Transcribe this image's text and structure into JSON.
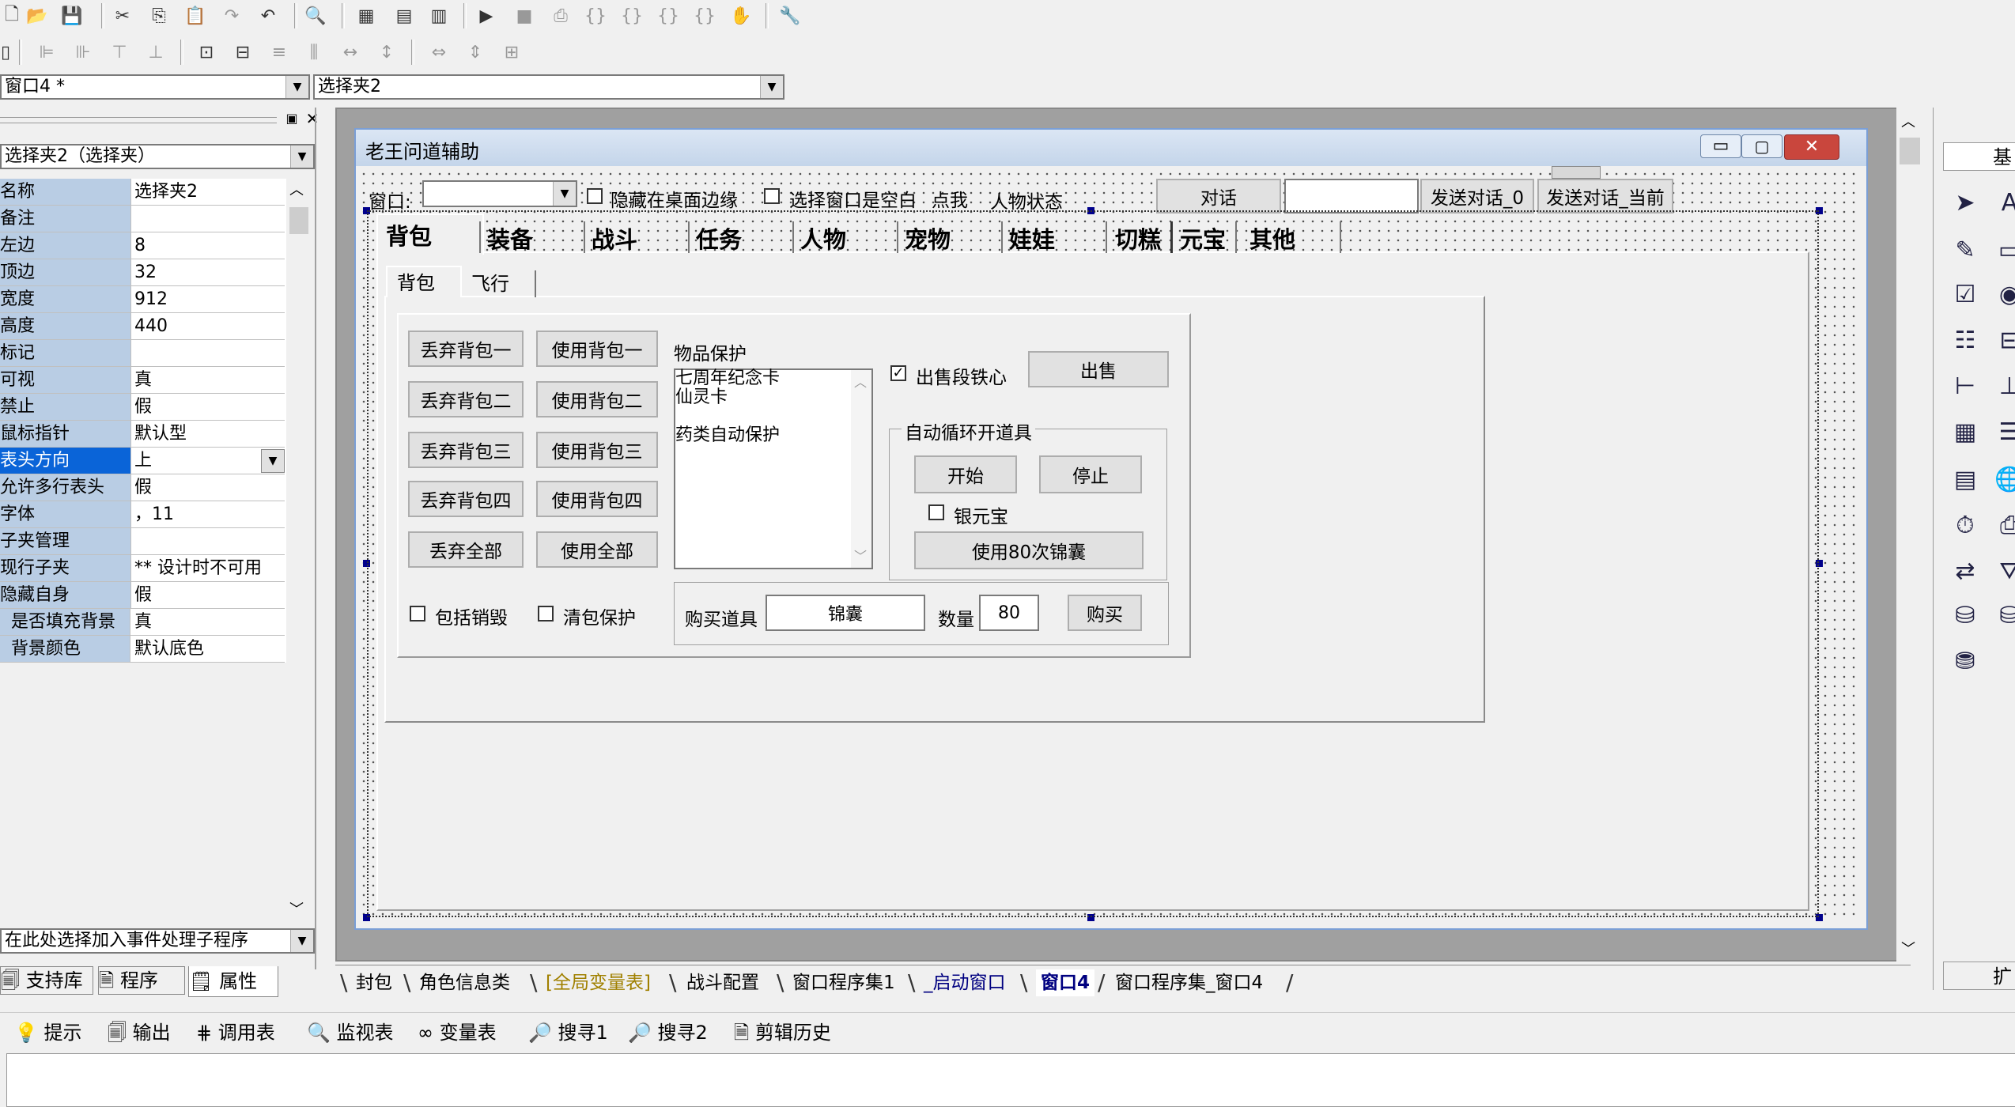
{
  "toolbar1": {
    "icons": [
      "new-icon",
      "open-icon",
      "save-icon",
      "cut-icon",
      "copy-icon",
      "paste-icon",
      "redo-icon",
      "undo-icon",
      "find-icon",
      "layout1-icon",
      "layout2-icon",
      "layout3-icon",
      "run-icon",
      "stop-icon",
      "step-icon",
      "step-into-icon",
      "step-over-icon",
      "step-out-icon",
      "run-to-icon",
      "hand-icon",
      "tools-icon"
    ]
  },
  "selectors": {
    "window_combo": "窗口4 *",
    "control_combo": "选择夹2"
  },
  "property_panel": {
    "object_combo": "选择夹2（选择夹）",
    "rows": [
      {
        "name": "名称",
        "value": "选择夹2"
      },
      {
        "name": "备注",
        "value": ""
      },
      {
        "name": "左边",
        "value": "8"
      },
      {
        "name": "顶边",
        "value": "32"
      },
      {
        "name": "宽度",
        "value": "912"
      },
      {
        "name": "高度",
        "value": "440"
      },
      {
        "name": "标记",
        "value": ""
      },
      {
        "name": "可视",
        "value": "真"
      },
      {
        "name": "禁止",
        "value": "假"
      },
      {
        "name": "鼠标指针",
        "value": "默认型"
      },
      {
        "name": "表头方向",
        "value": "上"
      },
      {
        "name": "允许多行表头",
        "value": "假"
      },
      {
        "name": "字体",
        "value": "，11"
      },
      {
        "name": "子夹管理",
        "value": ""
      },
      {
        "name": "现行子夹",
        "value": "** 设计时不可用"
      },
      {
        "name": "隐藏自身",
        "value": "假"
      },
      {
        "name": "是否填充背景",
        "value": "真"
      },
      {
        "name": "背景颜色",
        "value": "默认底色"
      }
    ],
    "event_combo": "在此处选择加入事件处理子程序",
    "tabs": [
      "支持库",
      "程序",
      "属性"
    ]
  },
  "form": {
    "title": "老王问道辅助",
    "window_label": "窗口:",
    "hide_edge": "隐藏在桌面边缘",
    "select_blank": "选择窗口是空白",
    "click_me": "点我",
    "char_status": "人物状态",
    "dialog_btn": "对话",
    "send_dialog_0": "发送对话_0",
    "send_dialog_cur": "发送对话_当前",
    "main_tabs": [
      "背包",
      "装备",
      "战斗",
      "任务",
      "人物",
      "宠物",
      "娃娃",
      "切糕",
      "元宝",
      "其他"
    ],
    "sub_tabs": [
      "背包",
      "飞行"
    ],
    "discard_buttons": [
      "丢弃背包一",
      "丢弃背包二",
      "丢弃背包三",
      "丢弃背包四",
      "丢弃全部"
    ],
    "use_buttons": [
      "使用背包一",
      "使用背包二",
      "使用背包三",
      "使用背包四",
      "使用全部"
    ],
    "protect_label": "物品保护",
    "protect_list": [
      "七周年纪念卡",
      "仙灵卡",
      "",
      "药类自动保护"
    ],
    "sell_iron": "出售段铁心",
    "sell_btn": "出售",
    "auto_group": "自动循环开道具",
    "start_btn": "开始",
    "stop_btn": "停止",
    "silver": "银元宝",
    "use80": "使用80次锦囊",
    "include_destroy": "包括销毁",
    "clear_protect": "清包保护",
    "buy_label": "购买道具",
    "buy_item": "锦囊",
    "qty_label": "数量",
    "qty": "80",
    "buy_btn": "购买"
  },
  "editor_tabs": [
    "封包",
    "角色信息类",
    "[全局变量表]",
    "战斗配置",
    "窗口程序集1",
    "_启动窗口",
    "窗口4",
    "窗口程序集_窗口4"
  ],
  "bottom_tools": [
    "提示",
    "输出",
    "调用表",
    "监视表",
    "变量表",
    "搜寻1",
    "搜寻2",
    "剪辑历史"
  ],
  "right_panel": {
    "header": "基",
    "footer": "扩"
  }
}
